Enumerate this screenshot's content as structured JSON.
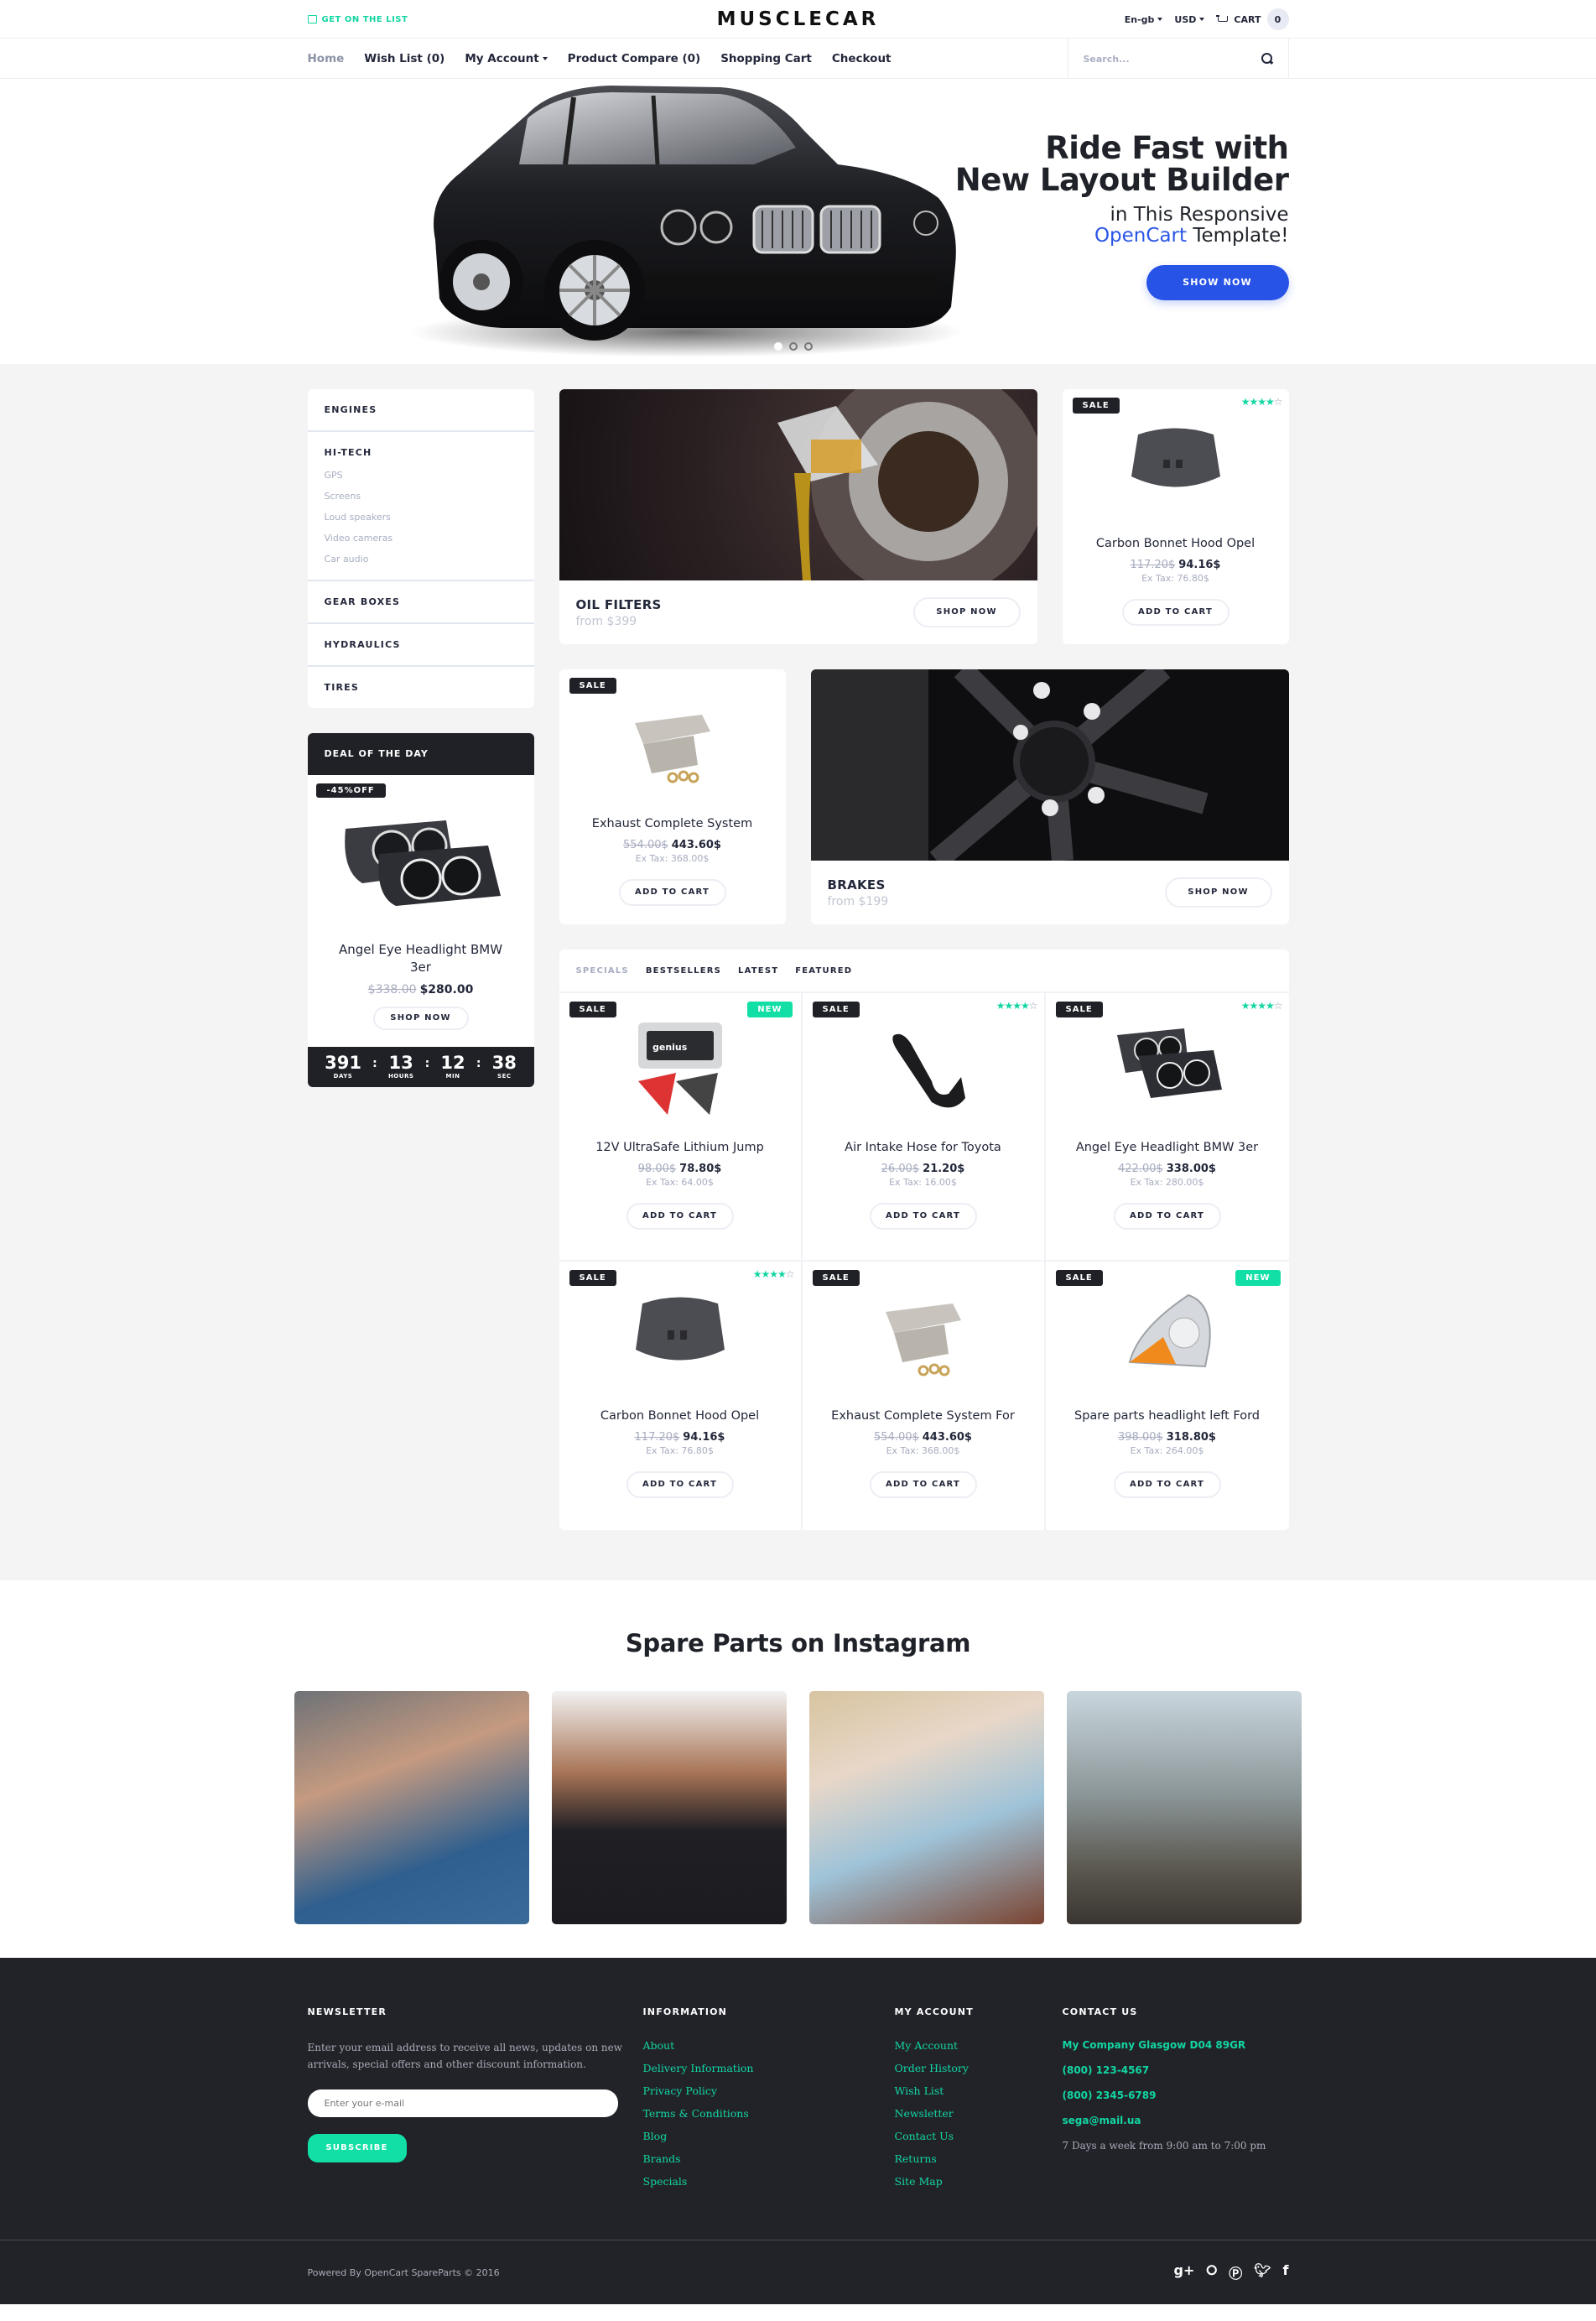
{
  "topbar": {
    "get_on_list": "GET ON THE LIST",
    "logo": "MUSCLECAR",
    "language": "En-gb",
    "currency": "USD",
    "cart_label": "CART",
    "cart_count": "0"
  },
  "nav": {
    "items": [
      "Home",
      "Wish List (0)",
      "My Account",
      "Product Compare (0)",
      "Shopping Cart",
      "Checkout"
    ],
    "search_placeholder": "Search..."
  },
  "hero": {
    "line1": "Ride Fast with",
    "line2": "New Layout Builder",
    "line3": "in This Responsive",
    "line4_accent": "OpenCart",
    "line4_rest": " Template!",
    "button": "SHOW NOW",
    "slides": 3,
    "active_slide": 1
  },
  "sidebar": {
    "categories": [
      {
        "label": "ENGINES"
      },
      {
        "label": "HI-TECH",
        "children": [
          "GPS",
          "Screens",
          "Loud speakers",
          "Video cameras",
          "Car audio"
        ]
      },
      {
        "label": "GEAR BOXES"
      },
      {
        "label": "HYDRAULICS"
      },
      {
        "label": "TIRES"
      }
    ],
    "deal": {
      "title": "DEAL OF THE DAY",
      "discount": "-45%OFF",
      "name": "Angel Eye Headlight BMW 3er",
      "old_price": "$338.00",
      "price": "$280.00",
      "button": "SHOP NOW",
      "countdown": {
        "days": "391",
        "days_label": "DAYS",
        "hours": "13",
        "hours_label": "HOURS",
        "min": "12",
        "min_label": "MIN",
        "sec": "38",
        "sec_label": "SEC"
      }
    }
  },
  "banners": {
    "oil": {
      "title": "OIL FILTERS",
      "from": "from $399",
      "button": "SHOP NOW"
    },
    "brakes": {
      "title": "BRAKES",
      "from": "from $199",
      "button": "SHOP NOW"
    }
  },
  "featured_cards": [
    {
      "badge": "SALE",
      "rating": 4,
      "name": "Carbon Bonnet Hood Opel",
      "old_price": "117.20$",
      "price": "94.16$",
      "ex_tax": "Ex Tax: 76.80$",
      "button": "ADD TO CART"
    },
    {
      "badge": "SALE",
      "name": "Exhaust Complete System",
      "old_price": "554.00$",
      "price": "443.60$",
      "ex_tax": "Ex Tax: 368.00$",
      "button": "ADD TO CART"
    }
  ],
  "tabs": {
    "items": [
      "SPECIALS",
      "BESTSELLERS",
      "LATEST",
      "FEATURED"
    ],
    "active": "SPECIALS"
  },
  "products": [
    {
      "badge": "SALE",
      "new": "NEW",
      "name": "12V UltraSafe Lithium Jump",
      "old_price": "98.00$",
      "price": "78.80$",
      "ex_tax": "Ex Tax: 64.00$",
      "button": "ADD TO CART"
    },
    {
      "badge": "SALE",
      "rating": 4,
      "name": "Air Intake Hose for Toyota",
      "old_price": "26.00$",
      "price": "21.20$",
      "ex_tax": "Ex Tax: 16.00$",
      "button": "ADD TO CART"
    },
    {
      "badge": "SALE",
      "rating": 4,
      "name": "Angel Eye Headlight BMW 3er",
      "old_price": "422.00$",
      "price": "338.00$",
      "ex_tax": "Ex Tax: 280.00$",
      "button": "ADD TO CART"
    },
    {
      "badge": "SALE",
      "rating": 4,
      "name": "Carbon Bonnet Hood Opel",
      "old_price": "117.20$",
      "price": "94.16$",
      "ex_tax": "Ex Tax: 76.80$",
      "button": "ADD TO CART"
    },
    {
      "badge": "SALE",
      "name": "Exhaust Complete System For",
      "old_price": "554.00$",
      "price": "443.60$",
      "ex_tax": "Ex Tax: 368.00$",
      "button": "ADD TO CART"
    },
    {
      "badge": "SALE",
      "new": "NEW",
      "name": "Spare parts headlight left Ford",
      "old_price": "398.00$",
      "price": "318.80$",
      "ex_tax": "Ex Tax: 264.00$",
      "button": "ADD TO CART"
    }
  ],
  "instagram": {
    "title": "Spare Parts on Instagram",
    "images": [
      "couple-with-glasses",
      "woman-in-black-top",
      "woman-in-hat-on-phone",
      "bearded-man-mountains"
    ]
  },
  "footer": {
    "newsletter": {
      "title": "NEWSLETTER",
      "text": "Enter your email address to receive all news, updates on new arrivals, special offers and other discount information.",
      "placeholder": "Enter your e-mail",
      "button": "SUBSCRIBE"
    },
    "information": {
      "title": "INFORMATION",
      "links": [
        "About",
        "Delivery Information",
        "Privacy Policy",
        "Terms & Conditions",
        "Blog",
        "Brands",
        "Specials"
      ]
    },
    "my_account": {
      "title": "MY ACCOUNT",
      "links": [
        "My Account",
        "Order History",
        "Wish List",
        "Newsletter",
        "Contact Us",
        "Returns",
        "Site Map"
      ]
    },
    "contact": {
      "title": "CONTACT US",
      "address": "My Company Glasgow D04 89GR",
      "phone1": "(800) 123-4567",
      "phone2": "(800) 2345-6789",
      "email": "sega@mail.ua",
      "hours": "7 Days a week from 9:00 am to 7:00 pm"
    },
    "powered": "Powered By OpenCart SpareParts © 2016",
    "social": [
      "google-plus",
      "rss",
      "pinterest",
      "twitter",
      "facebook"
    ]
  },
  "colors": {
    "accent_green": "#12dfa6",
    "accent_blue": "#2753e6",
    "dark": "#1f2127"
  }
}
